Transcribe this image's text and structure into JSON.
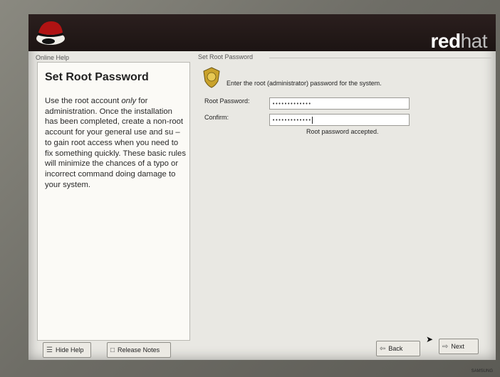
{
  "brand": {
    "bold": "red",
    "light": "hat"
  },
  "help": {
    "caption": "Online Help",
    "title": "Set Root Password",
    "text_before": "Use the root account ",
    "text_em": "only",
    "text_after": " for administration. Once the installation has been completed, create a non-root account for your general use and su  – to gain root access when you need to fix something quickly. These basic rules will minimize the chances of a typo or incorrect command doing damage to your system."
  },
  "main": {
    "caption": "Set Root Password",
    "instruction": "Enter the root (administrator) password for the system.",
    "root_password_label": "Root Password:",
    "root_password_value": "•••••••••••••",
    "confirm_label": "Confirm:",
    "confirm_value": "•••••••••••••",
    "status": "Root password accepted."
  },
  "buttons": {
    "hide_help": "Hide Help",
    "release_notes": "Release Notes",
    "back": "Back",
    "next": "Next"
  },
  "icons": {
    "hide_help": "help-book-icon",
    "release_notes": "document-icon",
    "back": "arrow-left-icon",
    "next": "arrow-right-icon",
    "badge": "security-badge-icon"
  },
  "colors": {
    "banner": "#1c1413",
    "background": "#e9e8e3",
    "brand_red": "#ffffff"
  },
  "monitor_label": "SAMSUNG"
}
